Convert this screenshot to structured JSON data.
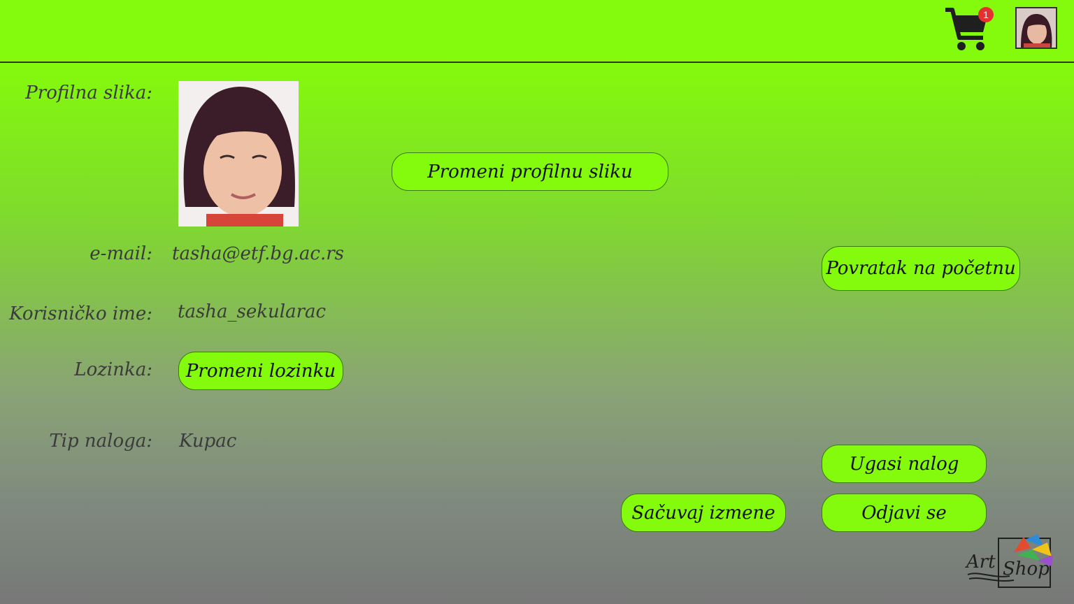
{
  "header": {
    "cart_count": "1",
    "cart_icon": "shopping-cart-icon",
    "avatar": "user-avatar"
  },
  "profile": {
    "picture_label": "Profilna slika:",
    "email_label": "e-mail:",
    "email_value": "tasha@etf.bg.ac.rs",
    "username_label": "Korisničko ime:",
    "username_value": "tasha_sekularac",
    "password_label": "Lozinka:",
    "account_type_label": "Tip naloga:",
    "account_type_value": "Kupac"
  },
  "buttons": {
    "change_picture": "Promeni profilnu sliku",
    "change_password": "Promeni lozinku",
    "back_home": "Povratak na početnu",
    "deactivate": "Ugasi nalog",
    "save": "Sačuvaj izmene",
    "logout": "Odjavi se"
  },
  "logo": {
    "art": "Art",
    "shop": "Shop"
  },
  "colors": {
    "accent": "#84fa0c",
    "badge": "#e53030"
  }
}
